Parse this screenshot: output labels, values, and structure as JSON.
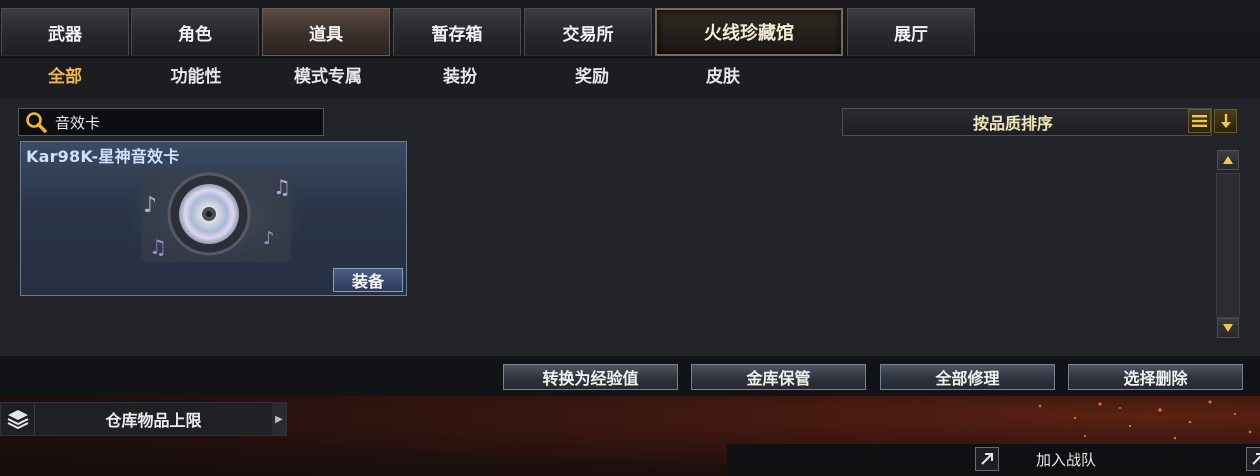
{
  "tabs": [
    {
      "label": "武器"
    },
    {
      "label": "角色"
    },
    {
      "label": "道具"
    },
    {
      "label": "暂存箱"
    },
    {
      "label": "交易所"
    },
    {
      "label": "火线珍藏馆"
    },
    {
      "label": "展厅"
    }
  ],
  "subtabs": [
    {
      "label": "全部"
    },
    {
      "label": "功能性"
    },
    {
      "label": "模式专属"
    },
    {
      "label": "装扮"
    },
    {
      "label": "奖励"
    },
    {
      "label": "皮肤"
    }
  ],
  "search": {
    "value": "音效卡",
    "icon": "search-icon"
  },
  "sort": {
    "label": "按品质排序",
    "list_icon": "list-icon",
    "order_icon": "arrow-down-icon"
  },
  "items": [
    {
      "name": "Kar98K-星神音效卡",
      "button": "装备",
      "icon": "music-disc-icon"
    }
  ],
  "actions": [
    {
      "label": "转换为经验值"
    },
    {
      "label": "金库保管"
    },
    {
      "label": "全部修理"
    },
    {
      "label": "选择删除"
    }
  ],
  "storage": {
    "label": "仓库物品上限",
    "icon": "stack-layers-icon"
  },
  "footer": {
    "team_label": "加入战队"
  },
  "colors": {
    "active_subtab": "#f0b649",
    "card_bg": "#2a3447",
    "gold_icon": "#f2c84a"
  }
}
